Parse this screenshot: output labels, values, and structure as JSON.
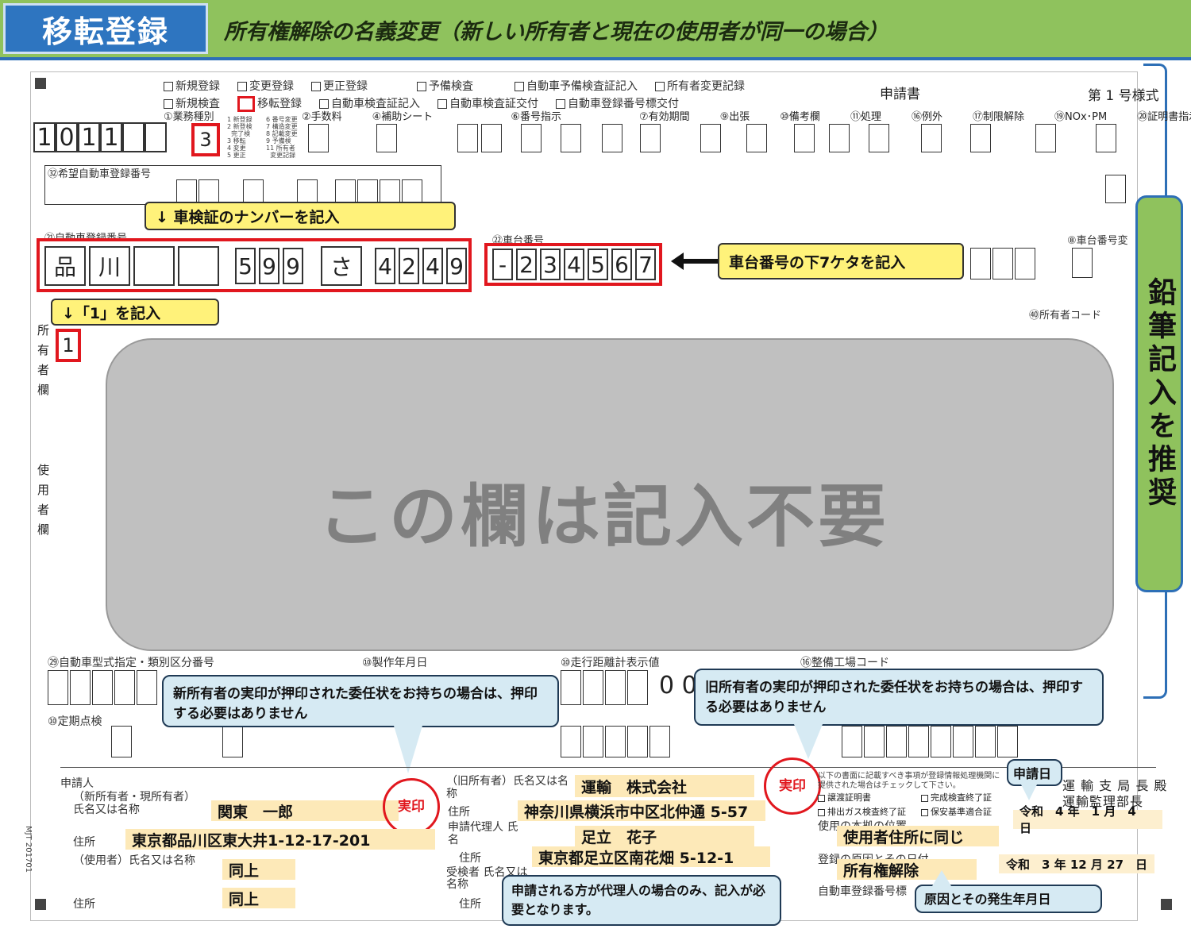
{
  "banner": {
    "tag": "移転登録",
    "title": "所有権解除の名義変更（新しい所有者と現在の使用者が同一の場合）"
  },
  "form": {
    "form_number": "第 1 号様式",
    "application_title": "申請書",
    "checkboxes_row1": [
      "新規登録",
      "変更登録",
      "更正登録",
      "予備検査",
      "自動車予備検査証記入",
      "所有者変更記録"
    ],
    "checkboxes_row2": [
      "新規検査",
      "移転登録",
      "自動車検査証記入",
      "自動車検査証交付",
      "自動車登録番号標交付"
    ],
    "form_code": "1011",
    "business_type_label": "①業務種別",
    "business_type_value": "3",
    "headers": [
      "②手数料",
      "④補助シート",
      "⑥番号指示",
      "⑦有効期間",
      "⑨出張",
      "⑩備考欄",
      "⑪処理",
      "⑯例外",
      "⑰制限解除",
      "⑲NOx･PM",
      "⑳証明書指示"
    ],
    "plate_label": "㉑自動車登録番号",
    "plate": [
      "品",
      "川",
      "",
      "",
      "5",
      "9",
      "9",
      "さ",
      "4",
      "2",
      "4",
      "9"
    ],
    "chassis_label": "㉒車台番号",
    "chassis": [
      "-",
      "2",
      "3",
      "4",
      "5",
      "6",
      "7"
    ],
    "owner_code_label": "㊵所有者コード",
    "owner_value": "1",
    "model_label": "㉙自動車型式指定・類別区分番号",
    "manufacture_label": "⑩製作年月日",
    "odometer_label": "⑩走行距離計表示値",
    "garage_label": "⑯整備工場コード",
    "periodic_label": "⑩定期点検",
    "side_labels": {
      "owner": "所有者欄",
      "user": "使用者欄"
    },
    "hope_label": "㉜希望自動車登録番号",
    "side_code": "MJT 201701"
  },
  "notes": {
    "plate_note": "↓ 車検証のナンバーを記入",
    "chassis_note": "車台番号の下7ケタを記入",
    "one_note": "↓「1」を記入",
    "overlay": "この欄は記入不要",
    "pencil": "鉛筆記入を推奨",
    "new_owner_note": "新所有者の実印が押印された委任状をお持ちの場合は、押印する必要はありません",
    "old_owner_note": "旧所有者の実印が押印された委任状をお持ちの場合は、押印する必要はありません",
    "agent_note": "申請される方が代理人の場合のみ、記入が必要となります。",
    "cause_note": "原因とその発生年月日",
    "date_note": "申請日"
  },
  "applicant": {
    "heading": "申請人",
    "new_owner_label": "（新所有者・現所有者）氏名又は名称",
    "new_owner_name": "関東　一郎",
    "address_label": "住所",
    "address": "東京都品川区東大井1-12-17-201",
    "user_label": "（使用者）氏名又は名称",
    "user_name": "同上",
    "user_address": "同上",
    "stamp": "実印"
  },
  "old_owner": {
    "label": "（旧所有者）氏名又は名称",
    "name": "運輸　株式会社",
    "address_label": "住所",
    "address": "神奈川県横浜市中区北仲通 5-57",
    "agent_label": "申請代理人 氏名",
    "agent_name": "足立　花子",
    "agent_address": "東京都足立区南花畑 5-12-1",
    "receiver_label": "受検者 氏名又は名称"
  },
  "right_block": {
    "office": "運 輸 支 局 長 殿",
    "office2": "運輸監理部長",
    "apply_date": "令和　4 年　1 月　4　日",
    "location_label": "使用の本拠の位置",
    "location": "使用者住所に同じ",
    "cause_label": "登録の原因とその日付",
    "cause": "所有権解除",
    "cause_date": "令和　3 年 12 月 27　日",
    "plate_no_label": "自動車登録番号標",
    "checks": [
      "譲渡証明書",
      "完成検査終了証",
      "排出ガス検査終了証",
      "保安基準適合証"
    ]
  }
}
